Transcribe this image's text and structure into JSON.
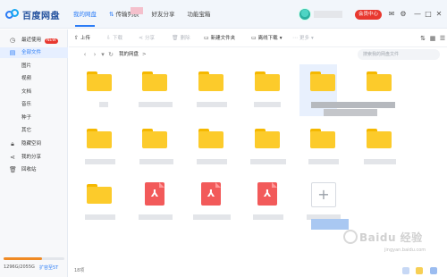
{
  "app": {
    "logo_text": "百度网盘",
    "nav": [
      {
        "label": "我的网盘",
        "active": true
      },
      {
        "label": "传输列表",
        "icon": "transfer-icon"
      },
      {
        "label": "好友分享"
      },
      {
        "label": "功能宝箱"
      }
    ],
    "vip_label": "会员中心",
    "accent": "#2b7cf6",
    "vip_color": "#e8382f"
  },
  "sidebar": {
    "items": [
      {
        "label": "最近使用",
        "badge": "NEW",
        "icon": "clock-icon"
      },
      {
        "label": "全部文件",
        "icon": "file-icon",
        "active": true
      },
      {
        "label": "图片"
      },
      {
        "label": "视频"
      },
      {
        "label": "文档"
      },
      {
        "label": "音乐"
      },
      {
        "label": "种子"
      },
      {
        "label": "其它"
      },
      {
        "label": "隐藏空间",
        "icon": "lock-icon"
      },
      {
        "label": "我的分享",
        "icon": "share-icon"
      },
      {
        "label": "回收站",
        "icon": "trash-icon"
      }
    ],
    "storage_text": "1296G/2055G",
    "storage_link": "扩容至5T",
    "storage_fraction": 0.63
  },
  "toolbar": {
    "upload": "上传",
    "download": "下载",
    "share": "分享",
    "delete": "删除",
    "new_folder": "新建文件夹",
    "offline_download": "离线下载",
    "more": "更多"
  },
  "pathbar": {
    "crumb": "我的网盘",
    "separator": ">",
    "search_placeholder": "搜索我的网盘文件"
  },
  "status": {
    "count": "18项"
  },
  "watermark": {
    "text": "Baidu 经验",
    "sub": "jingyan.baidu.com"
  }
}
